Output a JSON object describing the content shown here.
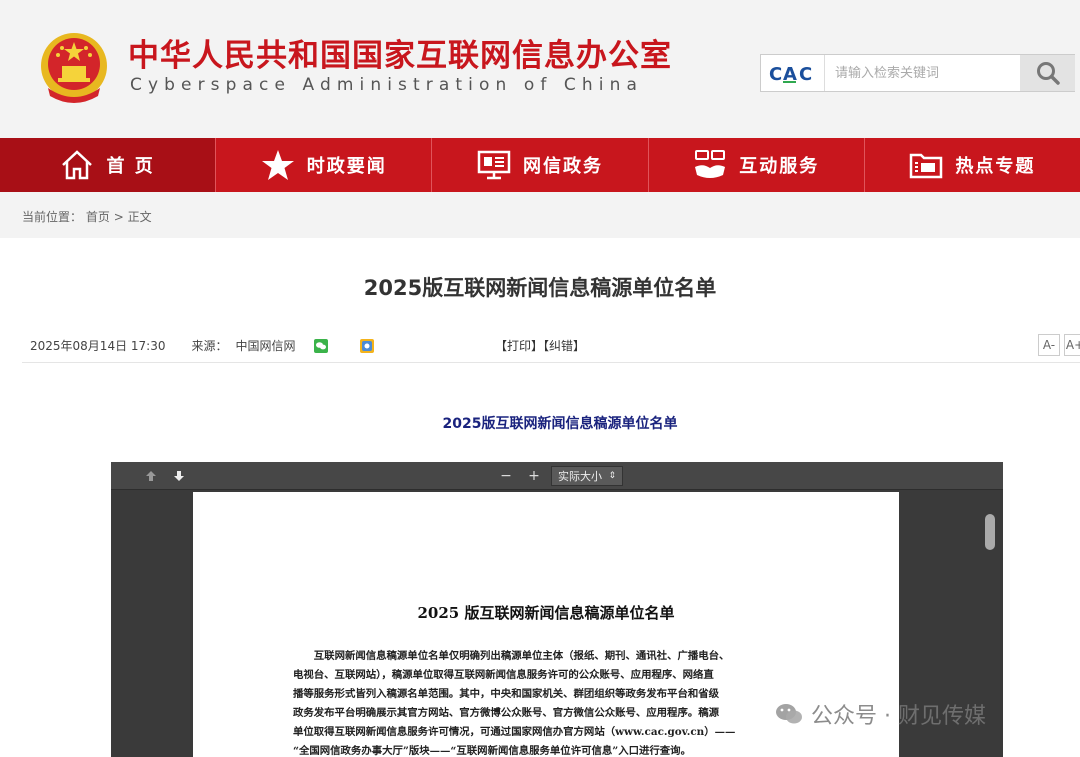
{
  "header": {
    "title_cn": "中华人民共和国国家互联网信息办公室",
    "title_en": "Cyberspace Administration of China",
    "search": {
      "logo_text": "CAC",
      "placeholder": "请输入检索关键词"
    }
  },
  "nav": {
    "items": [
      {
        "label": "首 页",
        "icon": "home-icon"
      },
      {
        "label": "时政要闻",
        "icon": "star-icon"
      },
      {
        "label": "网信政务",
        "icon": "monitor-icon"
      },
      {
        "label": "互动服务",
        "icon": "handshake-icon"
      },
      {
        "label": "热点专题",
        "icon": "folder-icon"
      }
    ]
  },
  "breadcrumb": {
    "prefix": "当前位置：",
    "home": "首页",
    "sep": " > ",
    "current": "正文"
  },
  "article": {
    "title": "2025版互联网新闻信息稿源单位名单",
    "date": "2025年08月14日 17:30",
    "source_label": "来源：",
    "source": "中国网信网",
    "print": "【打印】",
    "correct": "【纠错】",
    "font_small": "A-",
    "font_large": "A+",
    "subtitle": "2025版互联网新闻信息稿源单位名单"
  },
  "pdf": {
    "zoom_minus": "−",
    "zoom_plus": "+",
    "zoom_value": "实际大小",
    "doc_title": "2025 版互联网新闻信息稿源单位名单",
    "lines": [
      "互联网新闻信息稿源单位名单仅明确列出稿源单位主体（报纸、期刊、通讯社、广播电台、",
      "电视台、互联网站），稿源单位取得互联网新闻信息服务许可的公众账号、应用程序、网络直",
      "播等服务形式皆列入稿源名单范围。其中，中央和国家机关、群团组织等政务发布平台和省级",
      "政务发布平台明确展示其官方网站、官方微博公众账号、官方微信公众账号、应用程序。稿源",
      "单位取得互联网新闻信息服务许可情况，可通过国家网信办官方网站（www.cac.gov.cn）——",
      "“全国网信政务办事大厅”版块——“互联网新闻信息服务单位许可信息”入口进行查询。"
    ]
  },
  "watermark": {
    "text": "公众号 · 财见传媒"
  },
  "colors": {
    "brand_red": "#c8161d",
    "nav_active": "#a80f16",
    "subtitle_blue": "#1a237e"
  }
}
